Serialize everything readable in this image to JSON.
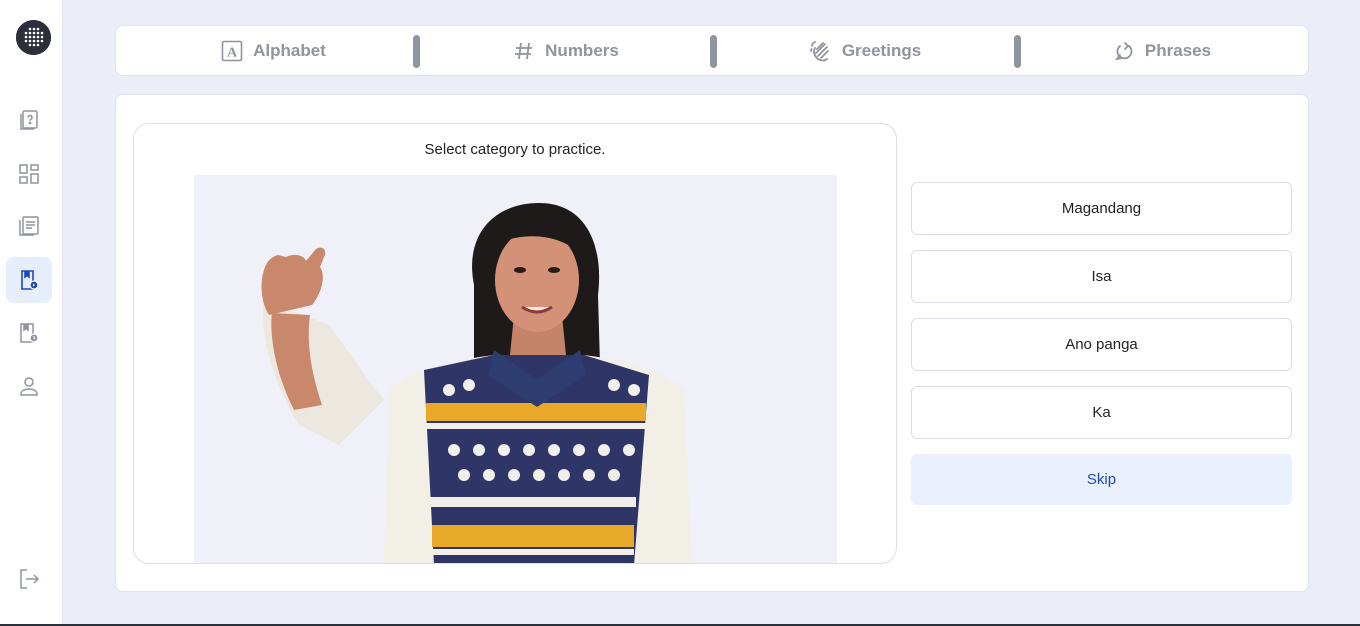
{
  "sidebar": {
    "items": [
      {
        "icon": "quiz-icon"
      },
      {
        "icon": "dashboard-icon"
      },
      {
        "icon": "lessons-icon"
      },
      {
        "icon": "practice-icon",
        "active": true
      },
      {
        "icon": "history-icon"
      },
      {
        "icon": "profile-icon"
      }
    ],
    "logout_icon": "logout-icon"
  },
  "tabs": [
    {
      "label": "Alphabet",
      "icon": "alphabet-icon"
    },
    {
      "label": "Numbers",
      "icon": "hash-icon"
    },
    {
      "label": "Greetings",
      "icon": "wave-hand-icon"
    },
    {
      "label": "Phrases",
      "icon": "chat-refresh-icon"
    }
  ],
  "practice": {
    "prompt": "Select category to practice.",
    "answers": [
      "Magandang",
      "Isa",
      "Ano panga",
      "Ka"
    ],
    "skip_label": "Skip"
  },
  "colors": {
    "background": "#eceef7",
    "accent": "#1f49b8",
    "skip_bg": "#eaf1fd",
    "tab_text": "#8f949e"
  }
}
